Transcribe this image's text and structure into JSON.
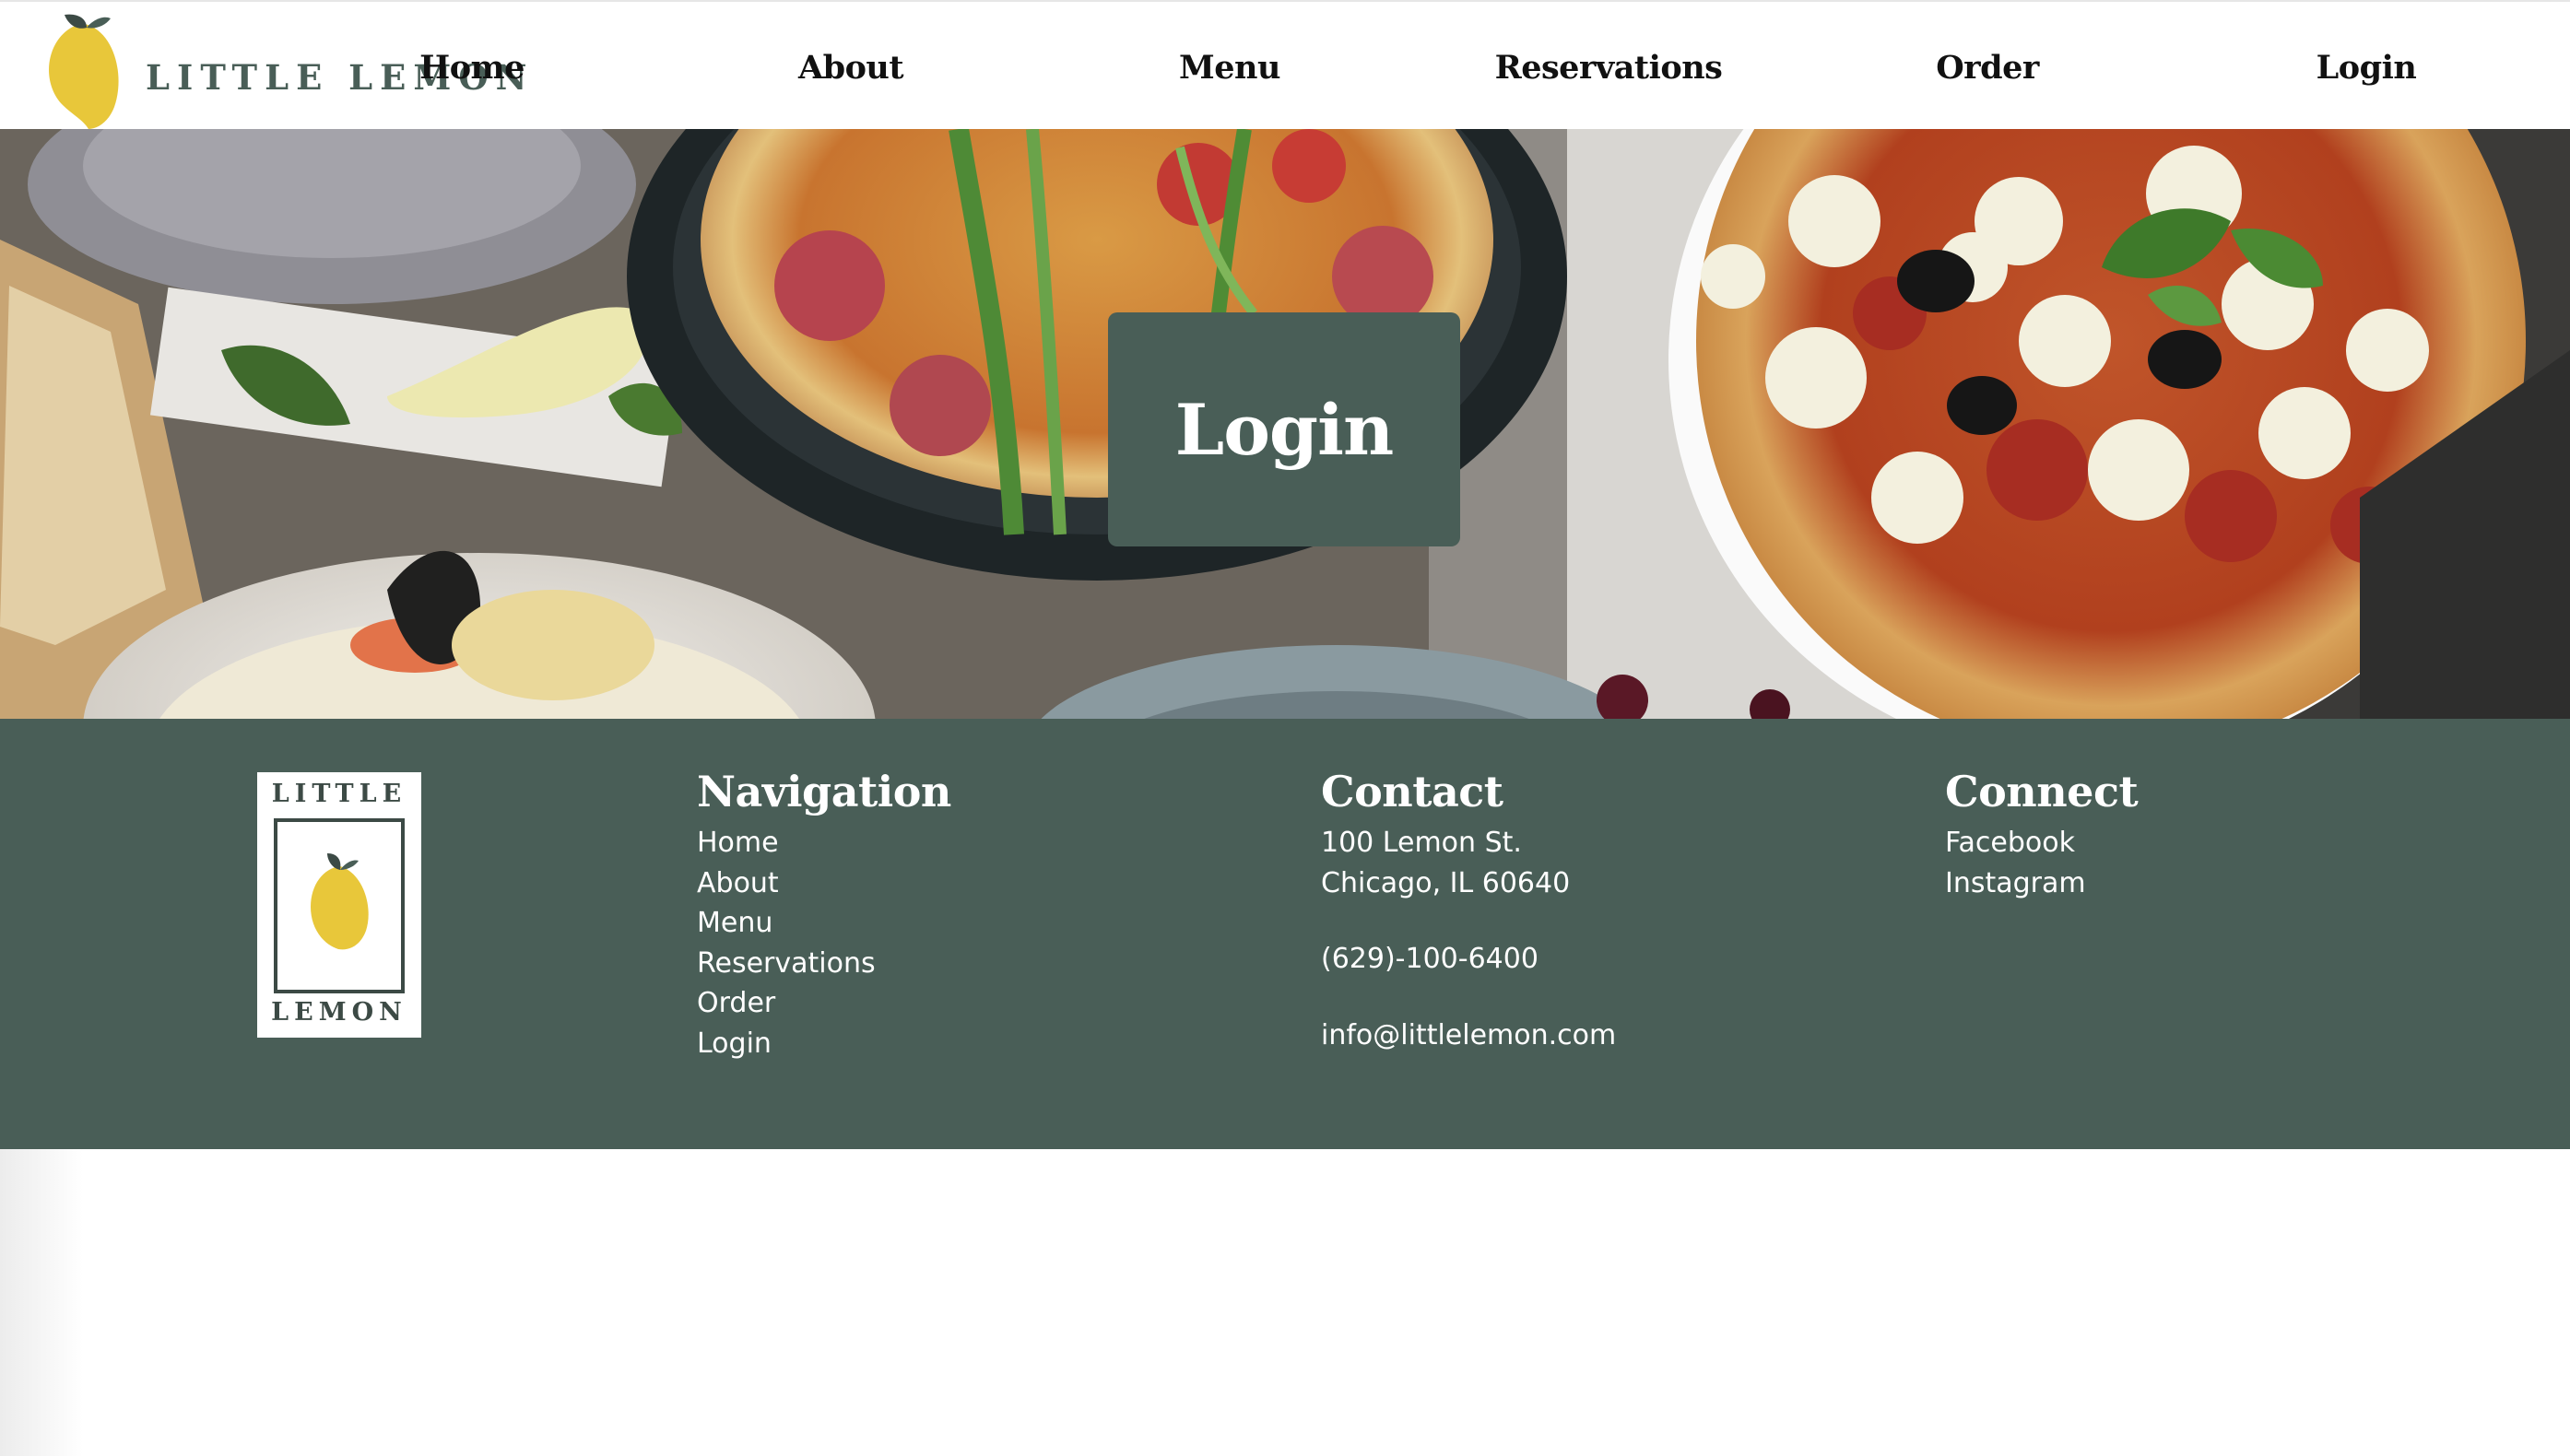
{
  "brand": {
    "name": "LITTLE LEMON"
  },
  "nav": {
    "items": [
      {
        "label": "Home"
      },
      {
        "label": "About"
      },
      {
        "label": "Menu"
      },
      {
        "label": "Reservations"
      },
      {
        "label": "Order"
      },
      {
        "label": "Login"
      }
    ]
  },
  "hero": {
    "title": "Login"
  },
  "footer": {
    "logo": {
      "top_word": "LITTLE",
      "bottom_word": "LEMON"
    },
    "navigation": {
      "heading": "Navigation",
      "links": [
        "Home",
        "About",
        "Menu",
        "Reservations",
        "Order",
        "Login"
      ]
    },
    "contact": {
      "heading": "Contact",
      "address_line1": "100 Lemon St.",
      "address_line2": "Chicago, IL 60640",
      "phone": "(629)-100-6400",
      "email": "info@littlelemon.com"
    },
    "connect": {
      "heading": "Connect",
      "links": [
        "Facebook",
        "Instagram"
      ]
    }
  },
  "colors": {
    "primary_green": "#495e57",
    "lemon_yellow": "#e8c73a",
    "text_dark": "#111111",
    "white": "#ffffff"
  },
  "icons": {
    "brand": "lemon-logo-icon",
    "footer": "lemon-logo-icon"
  }
}
